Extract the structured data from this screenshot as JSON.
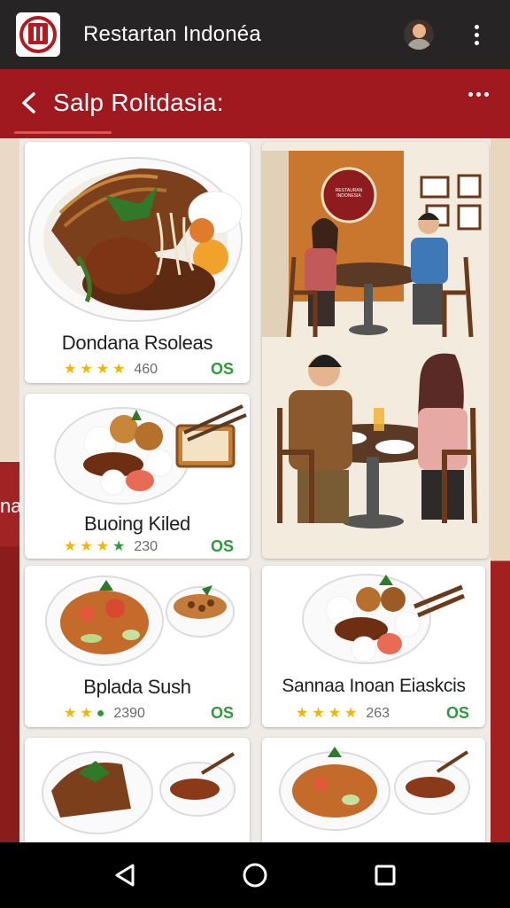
{
  "app": {
    "title": "Restartan Indonéa",
    "logo_icon": "restaurant-logo-icon",
    "avatar_icon": "user-avatar-icon",
    "menu_icon": "more-vert-icon"
  },
  "subheader": {
    "title": "Salp  Roltdasia:",
    "back_icon": "arrow-back-icon",
    "more_icon": "more-horiz-icon"
  },
  "side": {
    "left_text": "na"
  },
  "restaurant_photo": {
    "sign_text": "RESTAURAN INDONESIA"
  },
  "dishes": [
    {
      "name": "Dondana Rsoleas",
      "stars": 4,
      "rating": "460",
      "price": "OS"
    },
    {
      "name": "Buoing Kiled",
      "stars": 4,
      "rating": "230",
      "price": "OS"
    },
    {
      "name": "Bplada Sush",
      "stars": 3,
      "rating": "2390",
      "price": "OS"
    },
    {
      "name": "Sannaa Inoan Eiaskcis",
      "stars": 4,
      "rating": "263",
      "price": "OS"
    },
    {
      "name": "",
      "stars": 0,
      "rating": "",
      "price": ""
    },
    {
      "name": "",
      "stars": 0,
      "rating": "",
      "price": ""
    }
  ],
  "navbar": {
    "back_icon": "nav-back-icon",
    "home_icon": "nav-home-icon",
    "recents_icon": "nav-recents-icon"
  },
  "colors": {
    "appbar": "#262424",
    "brand_red": "#a0191f",
    "star": "#f4b400",
    "price_green": "#2e9a3a"
  }
}
